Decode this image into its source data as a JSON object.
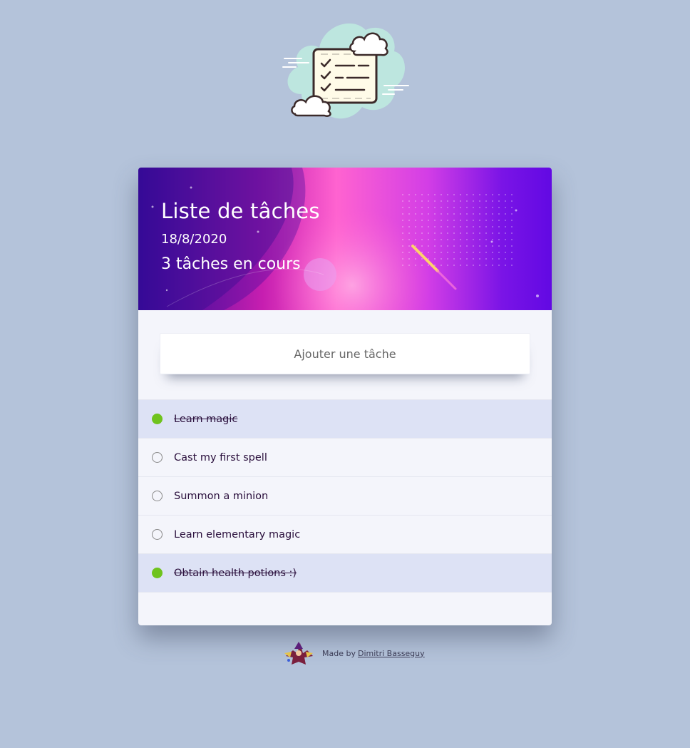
{
  "header": {
    "title": "Liste de tâches",
    "date": "18/8/2020",
    "task_count": "3 tâches en cours"
  },
  "add_task": {
    "placeholder": "Ajouter une tâche"
  },
  "tasks": [
    {
      "label": "Learn magic",
      "done": true
    },
    {
      "label": "Cast my first spell",
      "done": false
    },
    {
      "label": "Summon a minion",
      "done": false
    },
    {
      "label": "Learn elementary magic",
      "done": false
    },
    {
      "label": "Obtain health potions :)",
      "done": true
    }
  ],
  "footer": {
    "made_by": "Made by",
    "author": "Dimitri Basseguy"
  },
  "icons": {
    "logo": "checklist-cloud-icon",
    "avatar": "wizard-avatar-icon",
    "task_done": "checked-circle-icon",
    "task_pending": "empty-circle-icon"
  },
  "colors": {
    "background": "#b4c3da",
    "done_check": "#6fc31d",
    "done_row": "#dde2f5",
    "card": "#f4f5fb"
  }
}
